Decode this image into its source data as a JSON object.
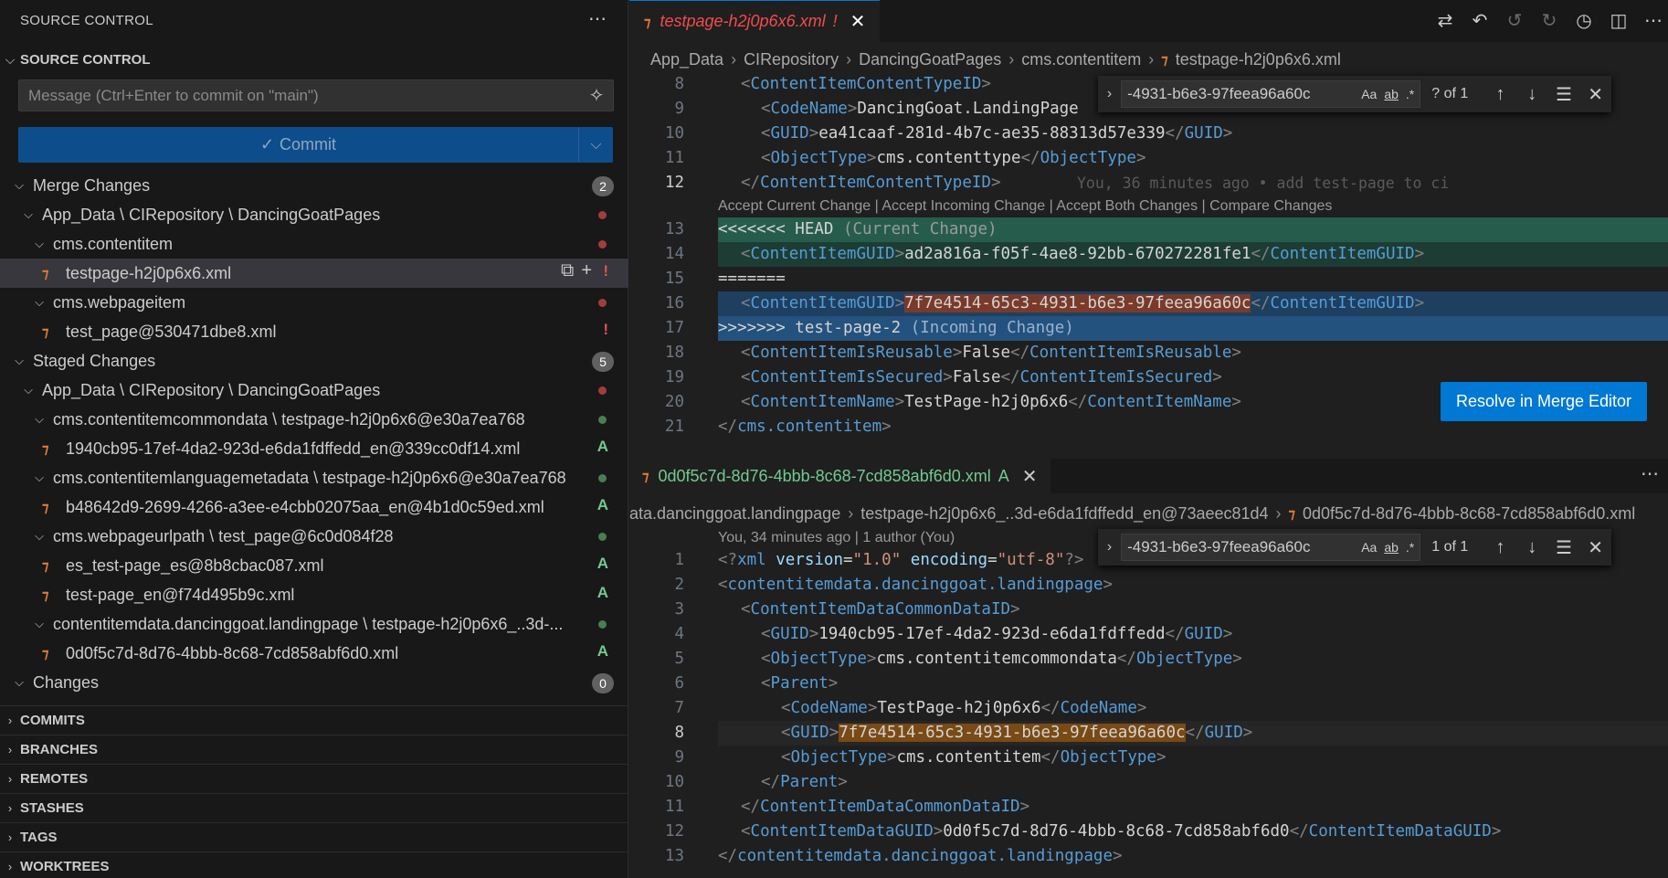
{
  "sidebar": {
    "title": "SOURCE CONTROL",
    "section": "SOURCE CONTROL",
    "message_placeholder": "Message (Ctrl+Enter to commit on \"main\")",
    "commit_label": "Commit",
    "rows": [
      {
        "label": "Merge Changes",
        "badge": "2"
      },
      {
        "label": "App_Data \\ CIRepository \\ DancingGoatPages"
      },
      {
        "label": "cms.contentitem"
      },
      {
        "label": "testpage-h2j0p6x6.xml",
        "status": "!"
      },
      {
        "label": "cms.webpageitem"
      },
      {
        "label": "test_page@530471dbe8.xml",
        "status": "!"
      },
      {
        "label": "Staged Changes",
        "badge": "5"
      },
      {
        "label": "App_Data \\ CIRepository \\ DancingGoatPages"
      },
      {
        "label": "cms.contentitemcommondata \\ testpage-h2j0p6x6@e30a7ea768"
      },
      {
        "label": "1940cb95-17ef-4da2-923d-e6da1fdffedd_en@339cc0df14.xml",
        "status": "A"
      },
      {
        "label": "cms.contentitemlanguagemetadata \\ testpage-h2j0p6x6@e30a7ea768"
      },
      {
        "label": "b48642d9-2699-4266-a3ee-e4cbb02075aa_en@4b1d0c59ed.xml",
        "status": "A"
      },
      {
        "label": "cms.webpageurlpath \\ test_page@6c0d084f28"
      },
      {
        "label": "es_test-page_es@8b8cbac087.xml",
        "status": "A"
      },
      {
        "label": "test-page_en@f74d495b9c.xml",
        "status": "A"
      },
      {
        "label": "contentitemdata.dancinggoat.landingpage \\ testpage-h2j0p6x6_..3d-..."
      },
      {
        "label": "0d0f5c7d-8d76-4bbb-8c68-7cd858abf6d0.xml",
        "status": "A"
      },
      {
        "label": "Changes",
        "badge": "0"
      }
    ],
    "bottom_sections": [
      "COMMITS",
      "BRANCHES",
      "REMOTES",
      "STASHES",
      "TAGS",
      "WORKTREES"
    ]
  },
  "editor1": {
    "tab_name": "testpage-h2j0p6x6.xml",
    "tab_flag": "!",
    "breadcrumb": [
      "App_Data",
      "CIRepository",
      "DancingGoatPages",
      "cms.contentitem",
      "testpage-h2j0p6x6.xml"
    ],
    "find": {
      "query": "-4931-b6e3-97feea96a60c",
      "count": "? of 1"
    },
    "blame": "You, 36 minutes ago • add test-page to ci",
    "codelens": "Accept Current Change | Accept Incoming Change | Accept Both Changes | Compare Changes",
    "resolve_label": "Resolve in Merge Editor"
  },
  "editor2": {
    "tab_name": "0d0f5c7d-8d76-4bbb-8c68-7cd858abf6d0.xml",
    "tab_status": "A",
    "breadcrumb": [
      "ata.dancinggoat.landingpage",
      "testpage-h2j0p6x6_..3d-e6da1fdffedd_en@73aeec81d4",
      "0d0f5c7d-8d76-4bbb-8c68-7cd858abf6d0.xml"
    ],
    "find": {
      "query": "-4931-b6e3-97feea96a60c",
      "count": "1 of 1"
    },
    "codelens": "You, 34 minutes ago | 1 author (You)"
  },
  "colors": {
    "accent": "#0078d4",
    "current_change_bg": "#265c4c",
    "incoming_change_bg": "#1e3f60",
    "incoming_header_bg": "#24527e",
    "added_status": "#73c991",
    "conflict_status": "#e5534b",
    "find_match": "#7a4a14"
  },
  "icons": [
    "more-icon",
    "sparkle-icon",
    "check-icon",
    "chevron-down-icon",
    "chevron-right-icon",
    "rss-file-icon",
    "open-file-icon",
    "plus-icon",
    "close-icon",
    "compare-icon",
    "revert-icon",
    "prev-change-icon",
    "next-change-icon",
    "timeline-icon",
    "split-editor-icon",
    "arrow-up-icon",
    "arrow-down-icon",
    "selection-icon"
  ]
}
